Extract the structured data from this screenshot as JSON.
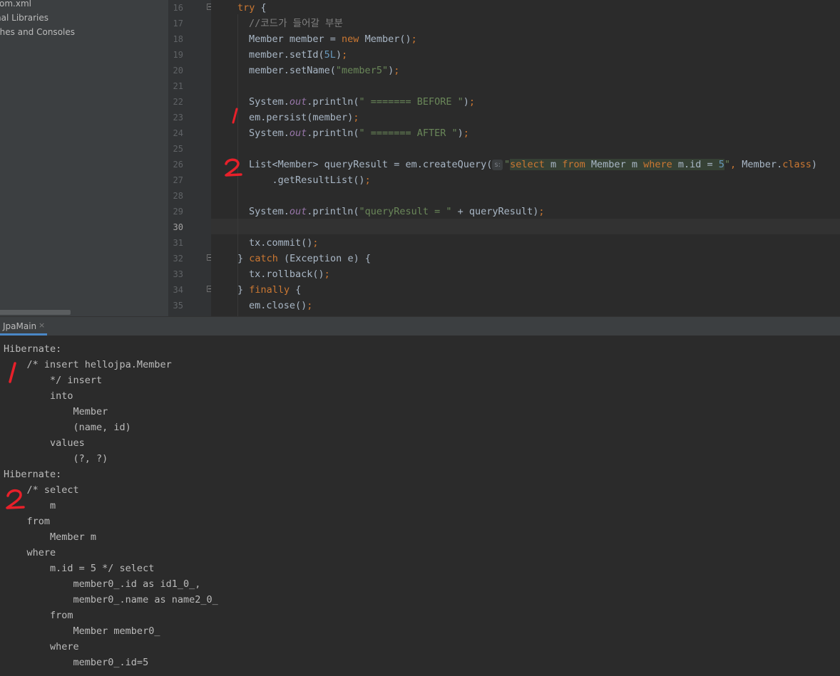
{
  "project_tree": {
    "items": [
      {
        "label": "pom.xml"
      },
      {
        "label": "External Libraries"
      },
      {
        "label": "Scratches and Consoles"
      }
    ]
  },
  "editor": {
    "line_numbers": [
      "16",
      "17",
      "18",
      "19",
      "20",
      "21",
      "22",
      "23",
      "24",
      "25",
      "26",
      "27",
      "28",
      "29",
      "30",
      "31",
      "32",
      "33",
      "34",
      "35"
    ],
    "current_line": "30",
    "lines": [
      {
        "n": "16",
        "tokens": [
          {
            "t": "try",
            "c": "kw"
          },
          {
            "t": " {"
          }
        ]
      },
      {
        "n": "17",
        "tokens": [
          {
            "t": "//코드가 들어갈 부분",
            "c": "cmt"
          }
        ]
      },
      {
        "n": "18",
        "tokens": [
          {
            "t": "Member member = "
          },
          {
            "t": "new",
            "c": "kw"
          },
          {
            "t": " Member()"
          },
          {
            "t": ";",
            "c": "kw"
          }
        ]
      },
      {
        "n": "19",
        "tokens": [
          {
            "t": "member.setId("
          },
          {
            "t": "5L",
            "c": "num"
          },
          {
            "t": ")"
          },
          {
            "t": ";",
            "c": "kw"
          }
        ]
      },
      {
        "n": "20",
        "tokens": [
          {
            "t": "member.setName("
          },
          {
            "t": "\"member5\"",
            "c": "str"
          },
          {
            "t": ")"
          },
          {
            "t": ";",
            "c": "kw"
          }
        ]
      },
      {
        "n": "21",
        "tokens": []
      },
      {
        "n": "22",
        "tokens": [
          {
            "t": "System."
          },
          {
            "t": "out",
            "c": "fld"
          },
          {
            "t": ".println("
          },
          {
            "t": "\" ======= BEFORE \"",
            "c": "str"
          },
          {
            "t": ")"
          },
          {
            "t": ";",
            "c": "kw"
          }
        ]
      },
      {
        "n": "23",
        "tokens": [
          {
            "t": "em.persist(member)"
          },
          {
            "t": ";",
            "c": "kw"
          }
        ]
      },
      {
        "n": "24",
        "tokens": [
          {
            "t": "System."
          },
          {
            "t": "out",
            "c": "fld"
          },
          {
            "t": ".println("
          },
          {
            "t": "\" ======= AFTER \"",
            "c": "str"
          },
          {
            "t": ")"
          },
          {
            "t": ";",
            "c": "kw"
          }
        ]
      },
      {
        "n": "25",
        "tokens": []
      },
      {
        "n": "26",
        "tokens": [
          {
            "t": "List<Member> queryResult = em.createQuery("
          },
          {
            "t": "s:",
            "c": "hint"
          },
          {
            "t": "\"",
            "c": "str"
          },
          {
            "t": "select",
            "c": "kw inj"
          },
          {
            "t": " m ",
            "c": "inj"
          },
          {
            "t": "from",
            "c": "kw inj"
          },
          {
            "t": " Member m ",
            "c": "inj"
          },
          {
            "t": "where",
            "c": "kw inj"
          },
          {
            "t": " m.id = ",
            "c": "inj"
          },
          {
            "t": "5",
            "c": "num inj"
          },
          {
            "t": "\"",
            "c": "str"
          },
          {
            "t": ", ",
            "c": "kw"
          },
          {
            "t": "Member."
          },
          {
            "t": "class",
            "c": "kw"
          },
          {
            "t": ")"
          }
        ]
      },
      {
        "n": "27",
        "tokens": [
          {
            "t": "    .getResultList()"
          },
          {
            "t": ";",
            "c": "kw"
          }
        ]
      },
      {
        "n": "28",
        "tokens": []
      },
      {
        "n": "29",
        "tokens": [
          {
            "t": "System."
          },
          {
            "t": "out",
            "c": "fld"
          },
          {
            "t": ".println("
          },
          {
            "t": "\"queryResult = \"",
            "c": "str"
          },
          {
            "t": " + queryResult)"
          },
          {
            "t": ";",
            "c": "kw"
          }
        ]
      },
      {
        "n": "30",
        "tokens": []
      },
      {
        "n": "31",
        "tokens": [
          {
            "t": "tx.commit()"
          },
          {
            "t": ";",
            "c": "kw"
          }
        ]
      },
      {
        "n": "32",
        "tokens": [
          {
            "t": "} "
          },
          {
            "t": "catch",
            "c": "kw"
          },
          {
            "t": " (Exception e) {"
          }
        ]
      },
      {
        "n": "33",
        "tokens": [
          {
            "t": "tx.rollback()"
          },
          {
            "t": ";",
            "c": "kw"
          }
        ]
      },
      {
        "n": "34",
        "tokens": [
          {
            "t": "} "
          },
          {
            "t": "finally",
            "c": "kw"
          },
          {
            "t": " {"
          }
        ]
      },
      {
        "n": "35",
        "tokens": [
          {
            "t": "em.close()"
          },
          {
            "t": ";",
            "c": "kw"
          }
        ]
      }
    ]
  },
  "run_panel": {
    "tab_label": "JpaMain",
    "close_glyph": "×",
    "console_lines": [
      "Hibernate: ",
      "    /* insert hellojpa.Member",
      "        */ insert ",
      "        into",
      "            Member",
      "            (name, id) ",
      "        values",
      "            (?, ?)",
      "Hibernate: ",
      "    /* select",
      "        m ",
      "    from",
      "        Member m ",
      "    where",
      "        m.id = 5 */ select",
      "            member0_.id as id1_0_,",
      "            member0_.name as name2_0_ ",
      "        from",
      "            Member member0_ ",
      "        where",
      "            member0_.id=5"
    ]
  },
  "annotations": {
    "color": "#e8202a",
    "marks": [
      {
        "label": "1",
        "where": "editor line 23"
      },
      {
        "label": "2",
        "where": "editor line 26"
      },
      {
        "label": "1",
        "where": "console insert block"
      },
      {
        "label": "2",
        "where": "console select block"
      }
    ]
  },
  "colors": {
    "keyword": "#cc7832",
    "string": "#6a8759",
    "number": "#6897bb",
    "comment": "#808080",
    "static_field": "#9876aa",
    "tab_accent": "#4a88c7"
  }
}
